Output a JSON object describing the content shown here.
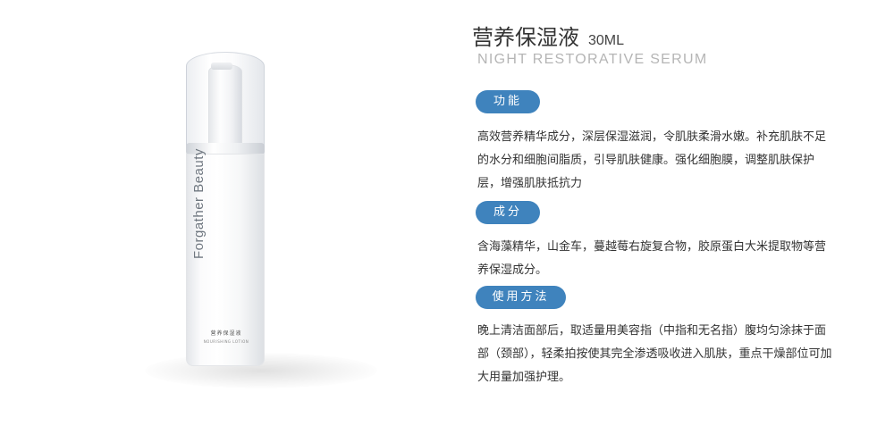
{
  "product": {
    "brand": "Forgather Beauty",
    "bottle_label_cn": "营养保湿液",
    "bottle_label_en": "NOURISHING LOTION"
  },
  "header": {
    "title": "营养保湿液",
    "volume": "30ML",
    "subtitle": "NIGHT RESTORATIVE SERUM"
  },
  "sections": [
    {
      "label": "功能",
      "text": "高效营养精华成分，深层保湿滋润，令肌肤柔滑水嫩。补充肌肤不足的水分和细胞间脂质，引导肌肤健康。强化细胞膜，调整肌肤保护层，增强肌肤抵抗力"
    },
    {
      "label": "成分",
      "text": "含海藻精华，山金车，蔓越莓右旋复合物，胶原蛋白大米提取物等营养保湿成分。"
    },
    {
      "label": "使用方法",
      "text": "晚上清洁面部后，取适量用美容指（中指和无名指）腹均匀涂抹于面部（颈部），轻柔拍按使其完全渗透吸收进入肌肤，重点干燥部位可加大用量加强护理。"
    }
  ],
  "colors": {
    "accent": "#3f83bd",
    "subtitle": "#b5b5b5"
  }
}
